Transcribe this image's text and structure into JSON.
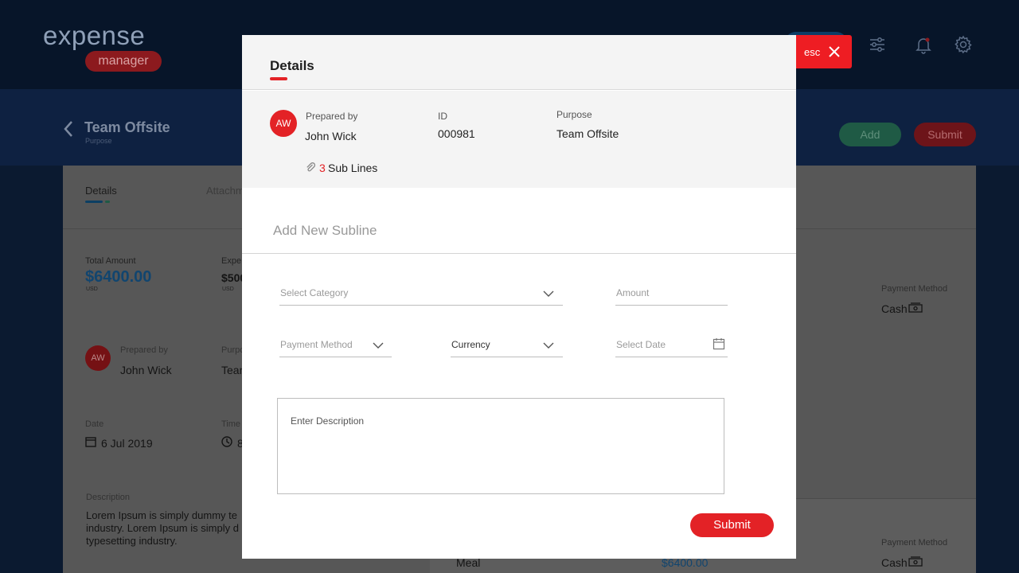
{
  "app": {
    "logo_text": "expense",
    "logo_sub": "manager"
  },
  "report": {
    "title": "Team Offsite",
    "subtitle": "Purpose",
    "add_label": "Add",
    "submit_label": "Submit",
    "tabs": [
      "Details",
      "Attachm"
    ],
    "total_amount_label": "Total Amount",
    "total_amount": "$6400.00",
    "total_currency": "USD",
    "expense_label": "Expe",
    "expense_value": "$500",
    "expense_currency": "USD",
    "avatar_initials": "AW",
    "prepared_by_label": "Prepared by",
    "prepared_by": "John Wick",
    "purpose_label": "Purpo",
    "purpose_value": "Tean",
    "date_label": "Date",
    "date_value": "6 Jul 2019",
    "time_label": "Time",
    "time_value": "8",
    "description_label": "Description",
    "description_lines": [
      "Lorem Ipsum is simply dummy te",
      "industry. Lorem Ipsum is simply d",
      "typesetting industry."
    ],
    "payment_method_label": "Payment Method",
    "payment_method_value": "Cash",
    "lower_payment_method_label": "Payment Method",
    "lower_payment_method_value": "Cash",
    "lower_item": "Meal",
    "lower_amount": "$6400.00"
  },
  "modal": {
    "title": "Details",
    "esc_label": "esc",
    "avatar_initials": "AW",
    "prepared_by_label": "Prepared by",
    "prepared_by": "John Wick",
    "id_label": "ID",
    "id_value": "000981",
    "purpose_label": "Purpose",
    "purpose_value": "Team Offsite",
    "sublines_count": "3",
    "sublines_text": "Sub Lines",
    "section_title": "Add New Subline",
    "fields": {
      "category_placeholder": "Select Category",
      "amount_placeholder": "Amount",
      "payment_method_placeholder": "Payment Method",
      "currency_value": "Currency",
      "date_placeholder": "Select Date",
      "description_placeholder": "Enter Description"
    },
    "submit_label": "Submit"
  },
  "colors": {
    "accent_red": "#e32226",
    "navy": "#071529"
  }
}
